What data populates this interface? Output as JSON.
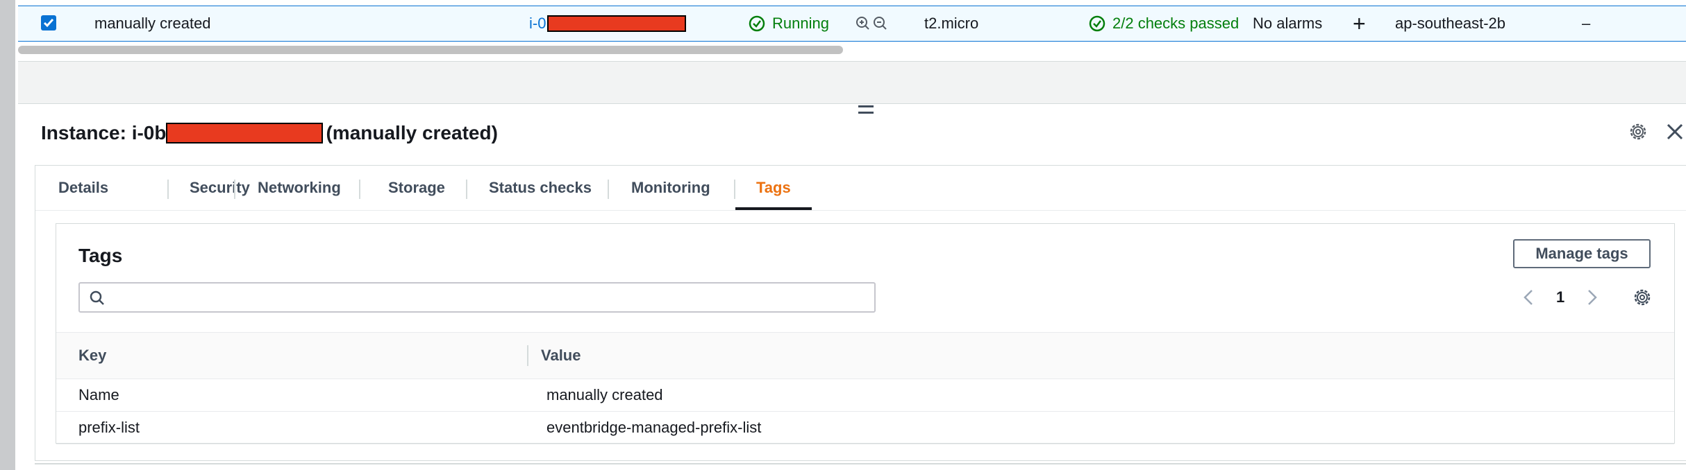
{
  "instance_row": {
    "name": "manually created",
    "id_prefix": "i-0",
    "state": "Running",
    "instance_type": "t2.micro",
    "status_checks": "2/2 checks passed",
    "alarms": "No alarms",
    "add_alarm": "+",
    "availability_zone": "ap-southeast-2b",
    "public_dns": "–"
  },
  "detail": {
    "title_prefix": "Instance: i-0b",
    "title_suffix": "(manually created)"
  },
  "tabs": [
    "Details",
    "Security",
    "Networking",
    "Storage",
    "Status checks",
    "Monitoring",
    "Tags"
  ],
  "active_tab": "Tags",
  "tags_panel": {
    "title": "Tags",
    "manage_button": "Manage tags",
    "search_placeholder": "",
    "page": "1",
    "columns": [
      "Key",
      "Value"
    ],
    "rows": [
      {
        "key": "Name",
        "value": "manually created"
      },
      {
        "key": "prefix-list",
        "value": "eventbridge-managed-prefix-list"
      }
    ]
  },
  "colors": {
    "link": "#0972d3",
    "success": "#037f0c",
    "active_tab": "#ec7211",
    "redaction": "#e83a1f"
  }
}
